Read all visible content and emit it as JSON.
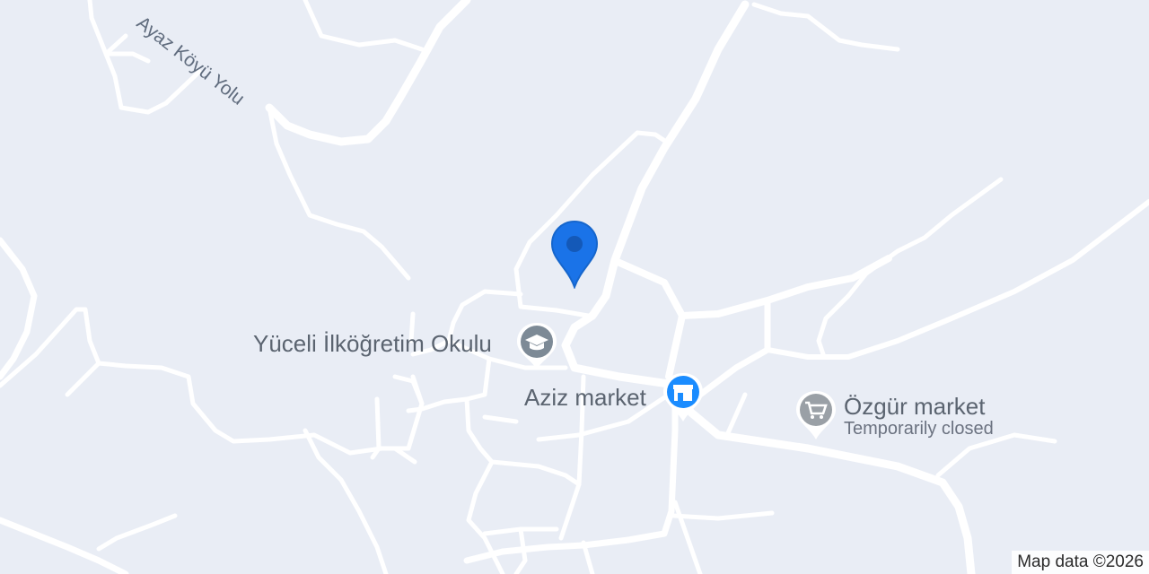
{
  "map": {
    "road_labels": [
      {
        "text": "Ayaz Köyü Yolu"
      }
    ],
    "pois": [
      {
        "name": "Yüceli İlköğretim Okulu",
        "icon": "school-icon",
        "color": "#7d8a96"
      },
      {
        "name": "Aziz market",
        "icon": "store-icon",
        "color": "#1a8cff"
      },
      {
        "name": "Özgür market",
        "subtitle": "Temporarily closed",
        "icon": "cart-icon",
        "color": "#9aa0a6"
      }
    ],
    "location_pin": {
      "color": "#1a73e8"
    },
    "attribution": "Map data ©2026"
  }
}
